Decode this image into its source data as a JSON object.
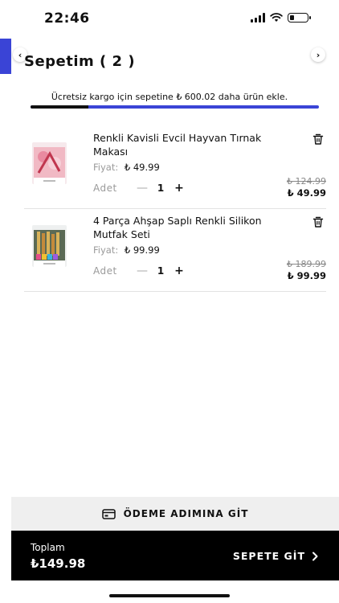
{
  "status": {
    "time": "22:46"
  },
  "header": {
    "title": "Sepetim ( 2 )"
  },
  "shipping": {
    "message": "Ücretsiz kargo için sepetine ₺ 600.02 daha ürün ekle.",
    "progress_fraction": 0.2
  },
  "cart": {
    "price_label": "Fiyat:",
    "qty_label": "Adet",
    "items": [
      {
        "name": "Renkli Kavisli Evcil Hayvan Tırnak Makası",
        "price": "₺ 49.99",
        "quantity": "1",
        "old_price": "₺ 124.99",
        "new_price": "₺ 49.99"
      },
      {
        "name": "4 Parça Ahşap Saplı Renkli Silikon Mutfak Seti",
        "price": "₺ 99.99",
        "quantity": "1",
        "old_price": "₺ 189.99",
        "new_price": "₺ 99.99"
      }
    ]
  },
  "checkout": {
    "label": "ÖDEME ADIMINA GİT"
  },
  "footer": {
    "total_label": "Toplam",
    "total_value": "₺149.98",
    "go_cart_label": "SEPETE GİT"
  },
  "colors": {
    "accent": "#3a44d6",
    "dark": "#000000"
  },
  "icons": [
    "signal-icon",
    "wifi-icon",
    "battery-icon",
    "chevron-left-icon",
    "chevron-right-icon",
    "trash-icon",
    "card-icon",
    "chevron-right-icon"
  ]
}
